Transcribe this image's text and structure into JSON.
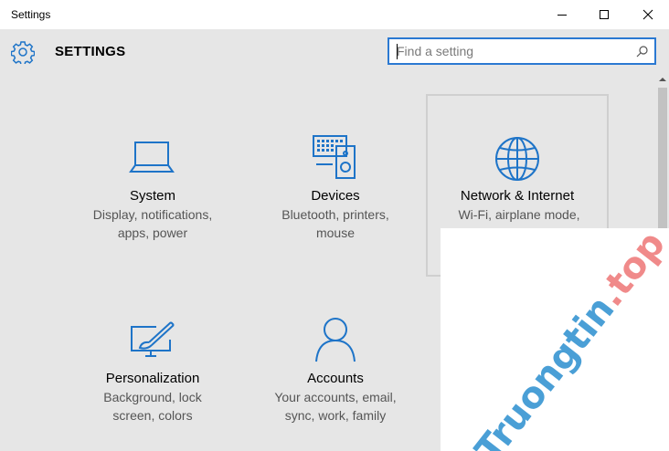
{
  "window": {
    "title": "Settings",
    "controls": {
      "minimize": "minimize-icon",
      "maximize": "maximize-icon",
      "close": "close-icon"
    }
  },
  "header": {
    "icon": "gear-icon",
    "title": "SETTINGS",
    "search_placeholder": "Find a setting",
    "search_value": "",
    "search_icon": "search-icon"
  },
  "accent_color": "#1e74c8",
  "categories": [
    {
      "name": "System",
      "desc_line1": "Display, notifications,",
      "desc_line2": "apps, power",
      "icon": "laptop-icon"
    },
    {
      "name": "Devices",
      "desc_line1": "Bluetooth, printers,",
      "desc_line2": "mouse",
      "icon": "devices-icon"
    },
    {
      "name": "Network & Internet",
      "desc_line1": "Wi-Fi, airplane mode,",
      "desc_line2": "",
      "icon": "globe-icon"
    },
    {
      "name": "Personalization",
      "desc_line1": "Background, lock",
      "desc_line2": "screen, colors",
      "icon": "personalization-icon"
    },
    {
      "name": "Accounts",
      "desc_line1": "Your accounts, email,",
      "desc_line2": "sync, work, family",
      "icon": "person-icon"
    }
  ],
  "watermark": {
    "part1": "Truongtin",
    "part2": ".top"
  }
}
